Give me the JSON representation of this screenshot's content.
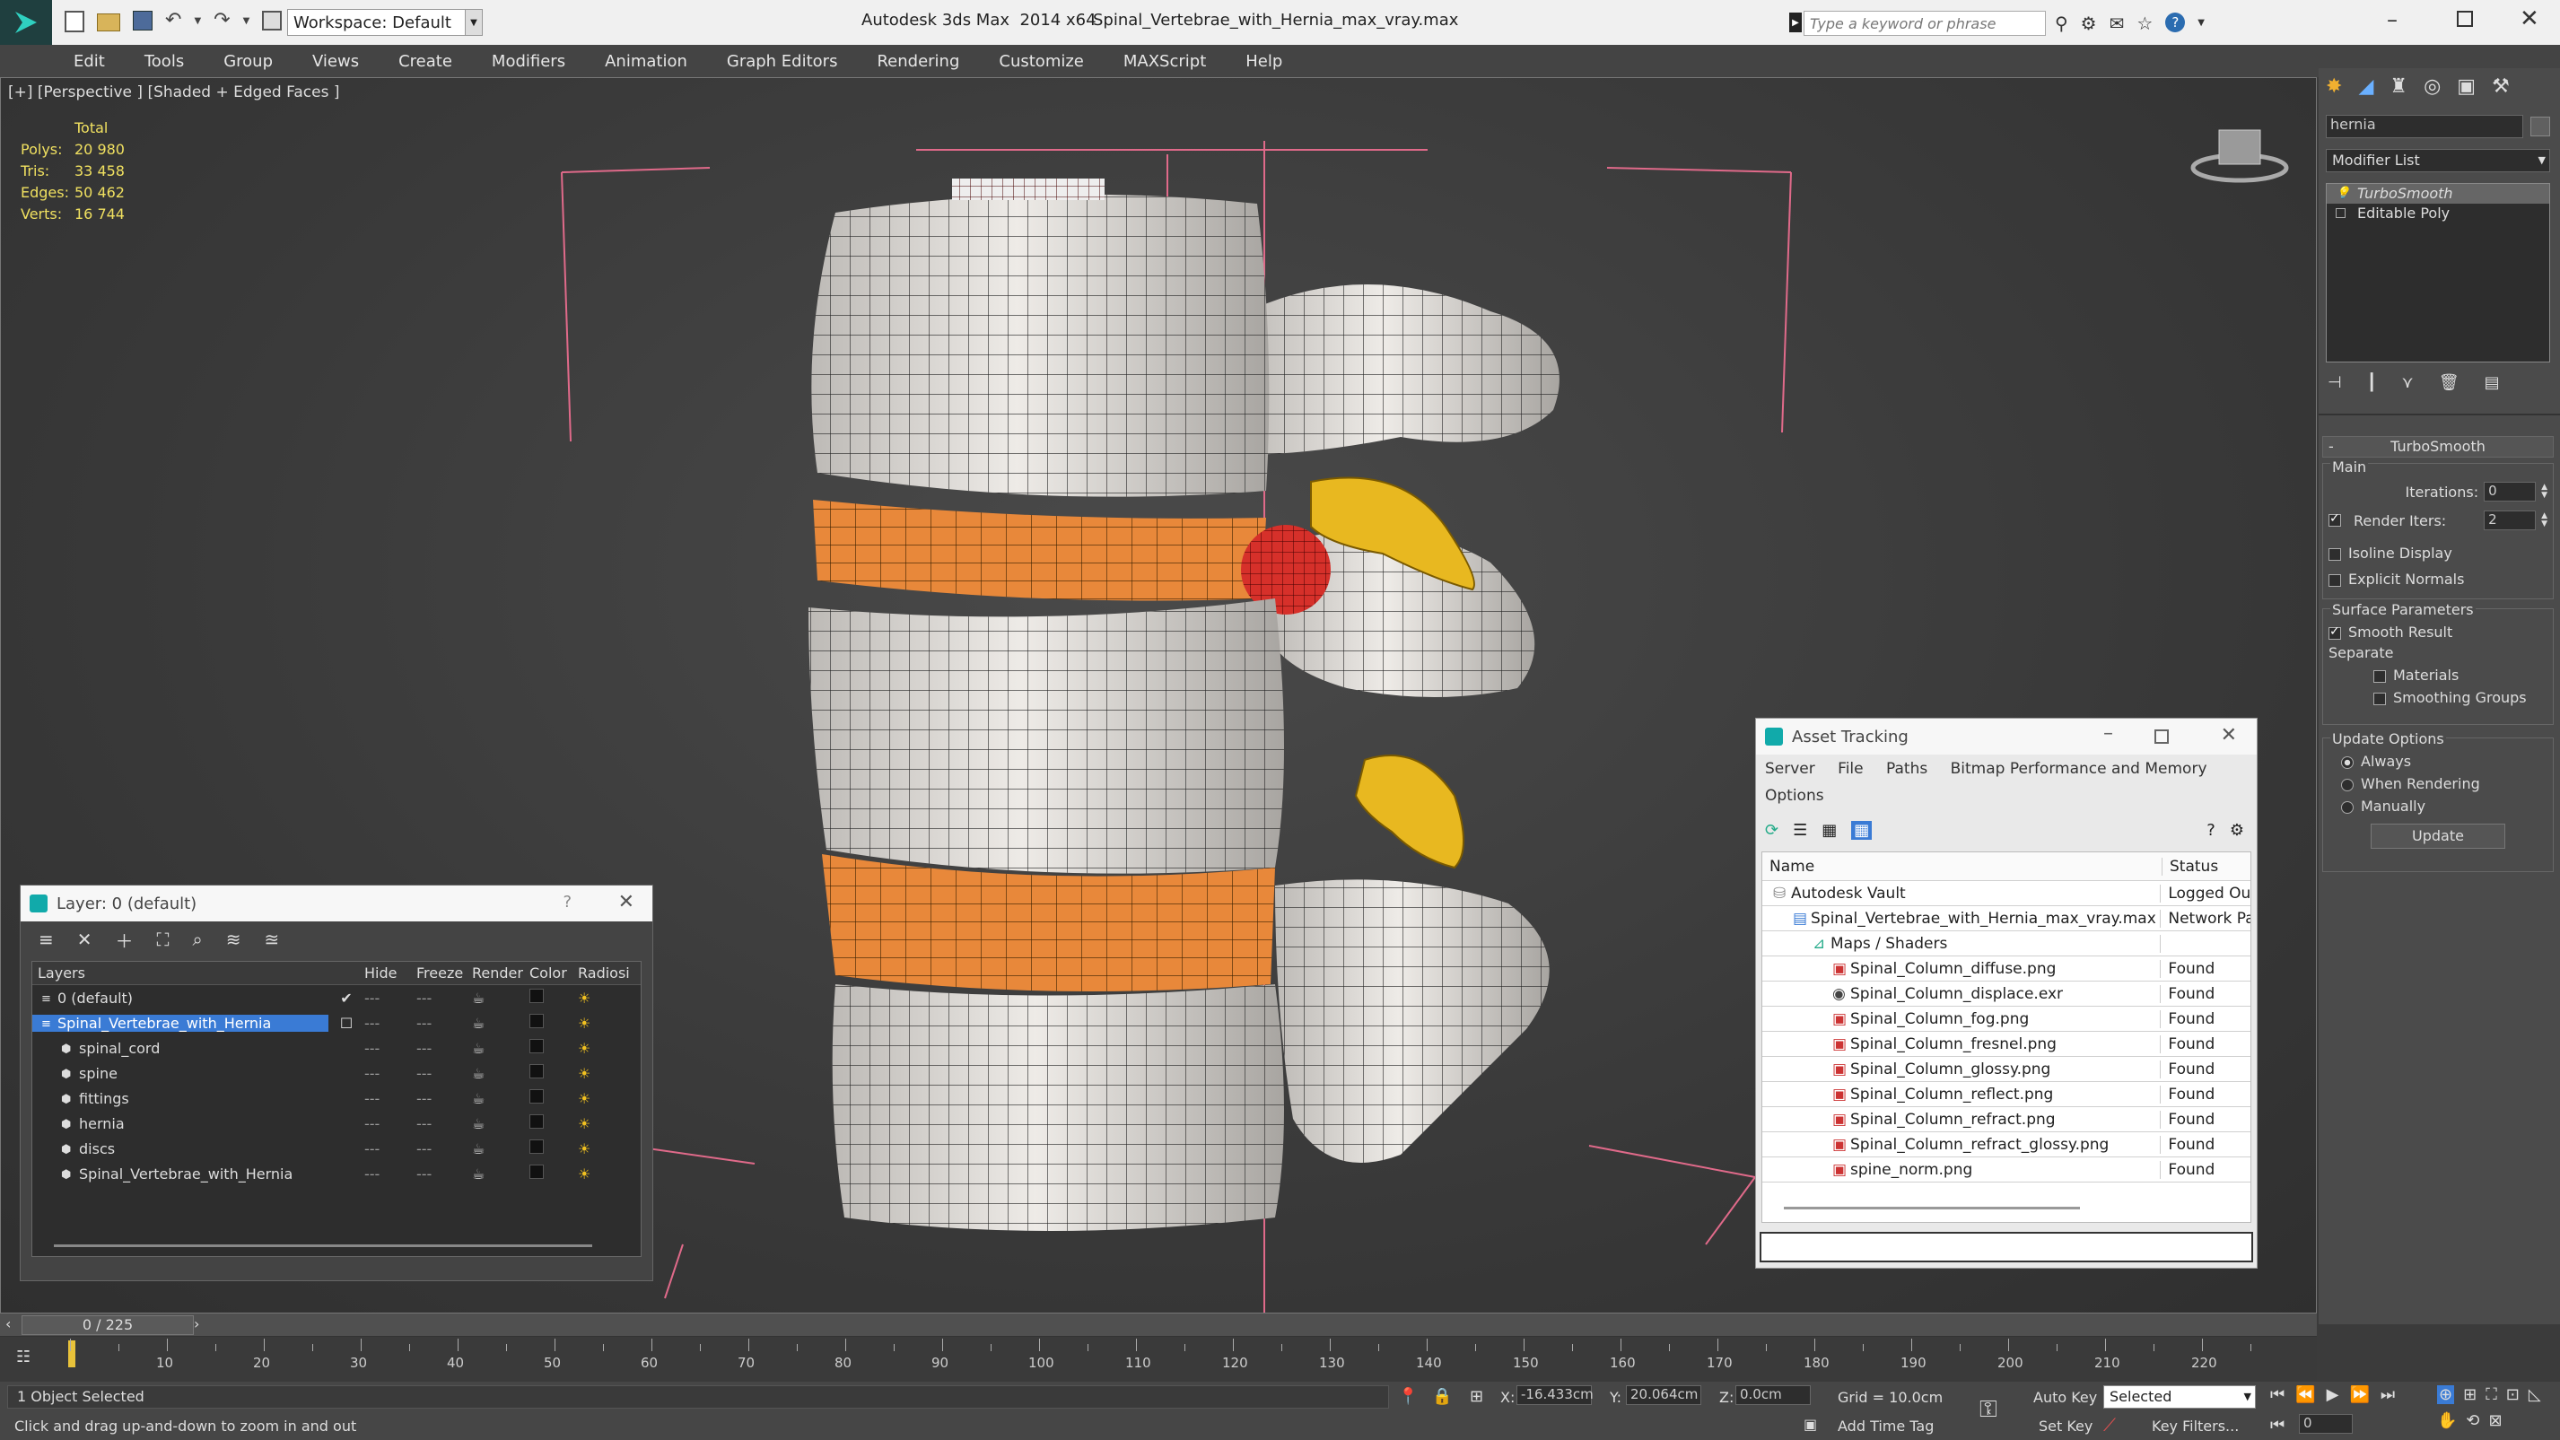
{
  "titlebar": {
    "workspace": "Workspace: Default",
    "app_title": "Autodesk 3ds Max  2014 x64",
    "file_title": "Spinal_Vertebrae_with_Hernia_max_vray.max",
    "search_placeholder": "Type a keyword or phrase"
  },
  "menu": [
    "Edit",
    "Tools",
    "Group",
    "Views",
    "Create",
    "Modifiers",
    "Animation",
    "Graph Editors",
    "Rendering",
    "Customize",
    "MAXScript",
    "Help"
  ],
  "viewport": {
    "label": "[+] [Perspective ] [Shaded + Edged Faces ]",
    "stats": {
      "header": "Total",
      "rows": [
        {
          "label": "Polys:",
          "value": "20 980"
        },
        {
          "label": "Tris:",
          "value": "33 458"
        },
        {
          "label": "Edges:",
          "value": "50 462"
        },
        {
          "label": "Verts:",
          "value": "16 744"
        }
      ]
    }
  },
  "command_panel": {
    "object_name": "hernia",
    "modifier_list": "Modifier List",
    "stack": [
      "TurboSmooth",
      "Editable Poly"
    ],
    "rollout_title": "TurboSmooth",
    "main_label": "Main",
    "iterations_label": "Iterations:",
    "iterations_value": "0",
    "render_iters_label": "Render Iters:",
    "render_iters_value": "2",
    "isoline": "Isoline Display",
    "explicit_normals": "Explicit Normals",
    "surface_params": "Surface Parameters",
    "smooth_result": "Smooth Result",
    "separate": "Separate",
    "materials": "Materials",
    "smoothing_groups": "Smoothing Groups",
    "update_options": "Update Options",
    "always": "Always",
    "when_rendering": "When Rendering",
    "manually": "Manually",
    "update_button": "Update"
  },
  "layer_window": {
    "title": "Layer: 0 (default)",
    "columns": [
      "Layers",
      "Hide",
      "Freeze",
      "Render",
      "Color",
      "Radiosi"
    ],
    "rows": [
      {
        "name": "0 (default)",
        "active": true,
        "selected": false,
        "child": false
      },
      {
        "name": "Spinal_Vertebrae_with_Hernia",
        "active": false,
        "selected": true,
        "child": false
      },
      {
        "name": "spinal_cord",
        "active": false,
        "selected": false,
        "child": true
      },
      {
        "name": "spine",
        "active": false,
        "selected": false,
        "child": true
      },
      {
        "name": "fittings",
        "active": false,
        "selected": false,
        "child": true
      },
      {
        "name": "hernia",
        "active": false,
        "selected": false,
        "child": true
      },
      {
        "name": "discs",
        "active": false,
        "selected": false,
        "child": true
      },
      {
        "name": "Spinal_Vertebrae_with_Hernia",
        "active": false,
        "selected": false,
        "child": true
      }
    ]
  },
  "asset_window": {
    "title": "Asset Tracking",
    "menu": [
      "Server",
      "File",
      "Paths",
      "Bitmap Performance and Memory"
    ],
    "menu2": "Options",
    "columns": [
      "Name",
      "Status"
    ],
    "rows": [
      {
        "name": "Autodesk Vault",
        "status": "Logged Out",
        "indent": 1,
        "icon": "vault"
      },
      {
        "name": "Spinal_Vertebrae_with_Hernia_max_vray.max",
        "status": "Network Pa",
        "indent": 2,
        "icon": "max"
      },
      {
        "name": "Maps / Shaders",
        "status": "",
        "indent": 3,
        "icon": "maps"
      },
      {
        "name": "Spinal_Column_diffuse.png",
        "status": "Found",
        "indent": 4,
        "icon": "png"
      },
      {
        "name": "Spinal_Column_displace.exr",
        "status": "Found",
        "indent": 4,
        "icon": "exr"
      },
      {
        "name": "Spinal_Column_fog.png",
        "status": "Found",
        "indent": 4,
        "icon": "png"
      },
      {
        "name": "Spinal_Column_fresnel.png",
        "status": "Found",
        "indent": 4,
        "icon": "png"
      },
      {
        "name": "Spinal_Column_glossy.png",
        "status": "Found",
        "indent": 4,
        "icon": "png"
      },
      {
        "name": "Spinal_Column_reflect.png",
        "status": "Found",
        "indent": 4,
        "icon": "png"
      },
      {
        "name": "Spinal_Column_refract.png",
        "status": "Found",
        "indent": 4,
        "icon": "png"
      },
      {
        "name": "Spinal_Column_refract_glossy.png",
        "status": "Found",
        "indent": 4,
        "icon": "png"
      },
      {
        "name": "spine_norm.png",
        "status": "Found",
        "indent": 4,
        "icon": "png"
      }
    ]
  },
  "timeline": {
    "frame_counter": "0 / 225",
    "ticks": [
      "10",
      "20",
      "30",
      "40",
      "50",
      "60",
      "70",
      "80",
      "90",
      "100",
      "110",
      "120",
      "130",
      "140",
      "150",
      "160",
      "170",
      "180",
      "190",
      "200",
      "210",
      "220"
    ]
  },
  "status": {
    "selection": "1 Object Selected",
    "prompt": "Click and drag up-and-down to zoom in and out",
    "x_label": "X:",
    "x_value": "-16.433cm",
    "y_label": "Y:",
    "y_value": "20.064cm",
    "z_label": "Z:",
    "z_value": "0.0cm",
    "grid": "Grid = 10.0cm",
    "auto_key": "Auto Key",
    "selected_dropdown": "Selected",
    "set_key": "Set Key",
    "key_filters": "Key Filters...",
    "add_time_tag": "Add Time Tag",
    "frame_value": "0"
  }
}
